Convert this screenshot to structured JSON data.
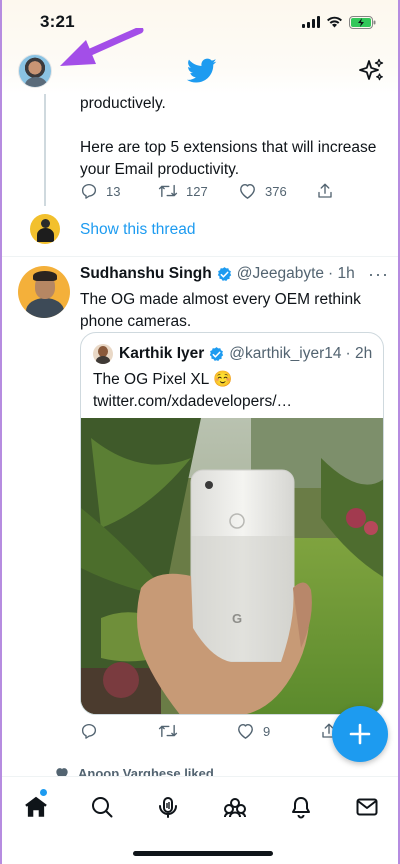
{
  "status_bar": {
    "time": "3:21"
  },
  "header": {
    "logo_icon": "twitter-bird-icon",
    "sparkle_icon": "sparkle-icon"
  },
  "previous_tweet": {
    "line1": "productively.",
    "line2": "Here are top 5 extensions that will increase your Email productivity.",
    "replies": "13",
    "retweets": "127",
    "likes": "376",
    "show_thread": "Show this thread"
  },
  "tweet": {
    "name": "Sudhanshu Singh",
    "handle": "@Jeegabyte",
    "time": "· 1h",
    "text": "The OG made almost every OEM rethink phone cameras.",
    "quote": {
      "name": "Karthik Iyer",
      "handle": "@karthik_iyer14",
      "time": "· 2h",
      "text": "The OG Pixel XL ☺️ twitter.com/xdadevelopers/…"
    },
    "likes": "9"
  },
  "activity": {
    "liked_text": "Anoop Varghese liked"
  },
  "colors": {
    "accent": "#1d9bf0",
    "text": "#0f1419",
    "secondary": "#536471",
    "arrow": "#a34ee8"
  }
}
